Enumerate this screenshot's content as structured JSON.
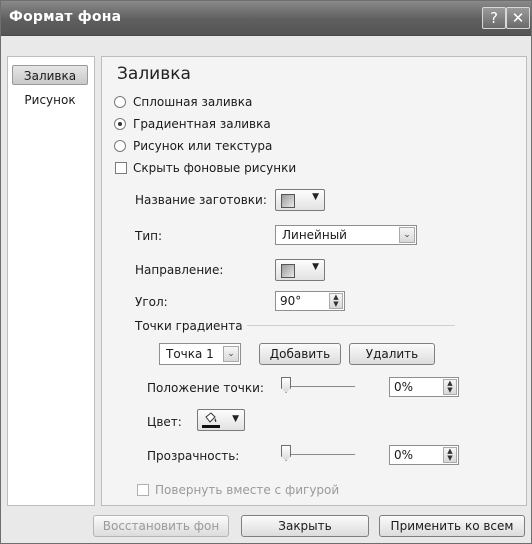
{
  "window": {
    "title": "Формат фона",
    "help_glyph": "?",
    "close_glyph": "✕"
  },
  "sidebar": {
    "items": [
      {
        "label": "Заливка",
        "active": true
      },
      {
        "label": "Рисунок",
        "active": false
      }
    ]
  },
  "fill": {
    "heading": "Заливка",
    "options": {
      "solid": "Сплошная заливка",
      "gradient": "Градиентная заливка",
      "picture": "Рисунок или текстура"
    },
    "selected_option": "gradient",
    "hide_background": {
      "label": "Скрыть фоновые рисунки",
      "checked": false
    },
    "preset": {
      "label": "Название заготовки:"
    },
    "type": {
      "label": "Тип:",
      "value": "Линейный"
    },
    "direction": {
      "label": "Направление:"
    },
    "angle": {
      "label": "Угол:",
      "value": "90°"
    }
  },
  "gradient_stops": {
    "group_label": "Точки градиента",
    "selected_stop": "Точка 1",
    "add_label": "Добавить",
    "remove_label": "Удалить",
    "position": {
      "label": "Положение точки:",
      "value": "0%",
      "level": 0
    },
    "color": {
      "label": "Цвет:",
      "color": "#111111"
    },
    "transparency": {
      "label": "Прозрачность:",
      "value": "0%",
      "level": 0
    }
  },
  "rotate_with_shape": {
    "label": "Повернуть вместе с фигурой",
    "checked": false,
    "enabled": false
  },
  "footer": {
    "reset_label": "Восстановить фон",
    "close_label": "Закрыть",
    "apply_all_label": "Применить ко всем"
  },
  "colors": {
    "titlebar": "#5e5e5e",
    "accent": "#c9c9c9"
  }
}
